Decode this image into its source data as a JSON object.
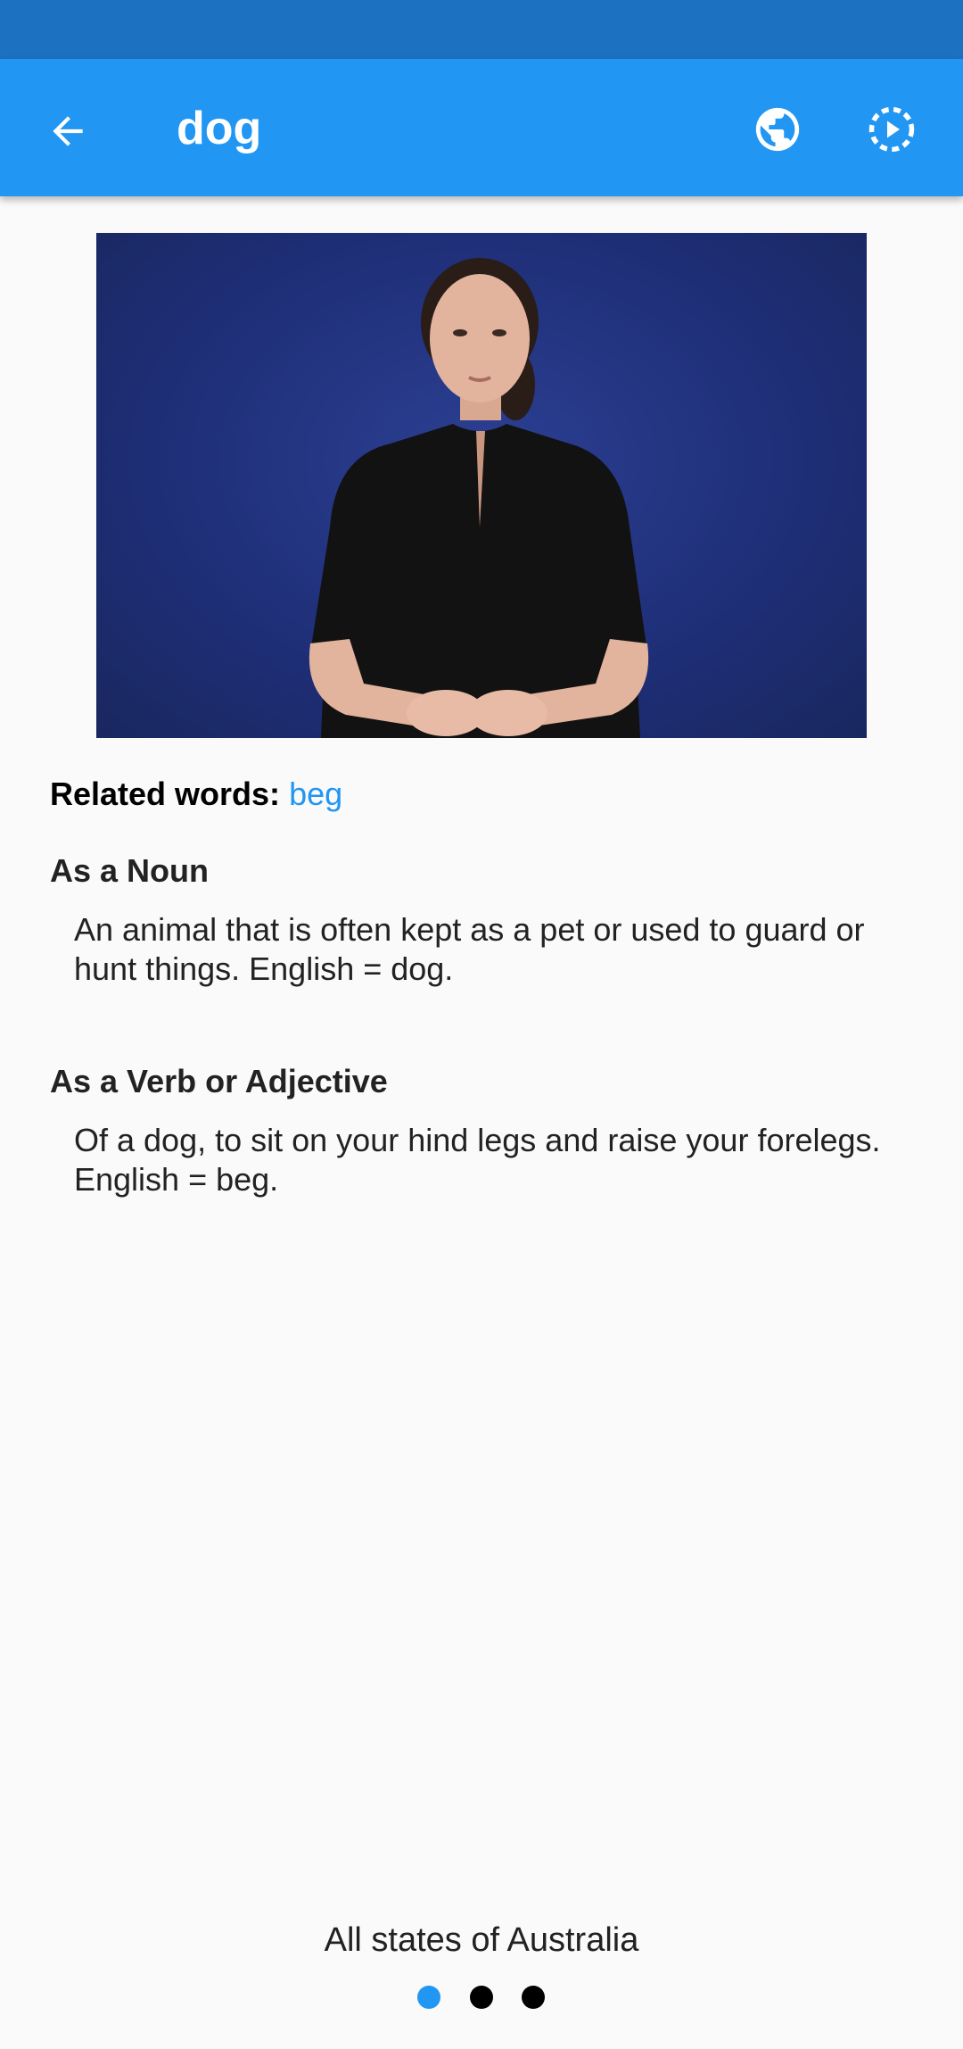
{
  "app_bar": {
    "title": "dog",
    "back_icon": "arrow-back-icon",
    "region_icon": "globe-icon",
    "playback_icon": "slow-motion-play-icon"
  },
  "video": {
    "description_icon": "sign-language-video"
  },
  "related": {
    "label": "Related words:",
    "words": [
      "beg"
    ]
  },
  "definitions": [
    {
      "heading": "As a Noun",
      "text": "An animal that is often kept as a pet or used to guard or hunt things. English = dog."
    },
    {
      "heading": "As a Verb or Adjective",
      "text": "Of a dog, to sit on your hind legs and raise your forelegs. English = beg."
    }
  ],
  "footer": {
    "region_text": "All states of Australia",
    "pages": 3,
    "active_page": 1
  },
  "colors": {
    "primary": "#2196f3",
    "status_bar": "#1c72c0",
    "background": "#fafafa",
    "link": "#2196f3"
  }
}
